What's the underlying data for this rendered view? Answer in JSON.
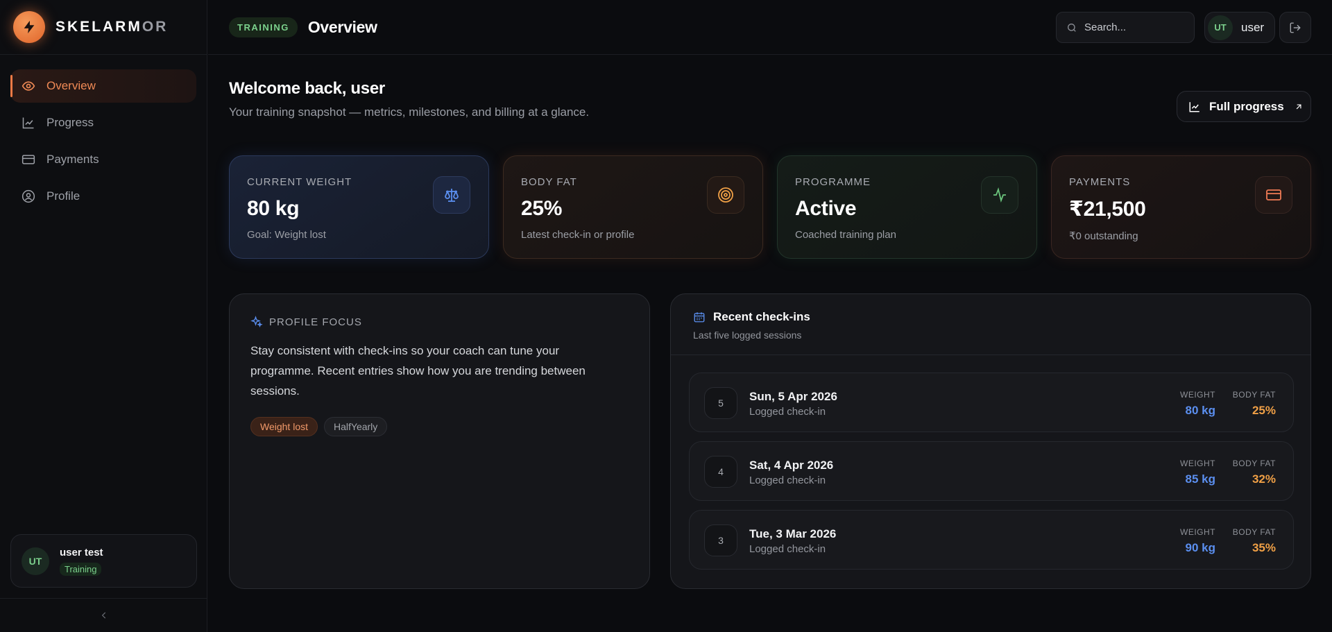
{
  "brand": {
    "name_bright": "SKELARM",
    "name_dim": "OR"
  },
  "sidebar": {
    "items": [
      {
        "label": "Overview",
        "icon": "eye-icon",
        "active": true
      },
      {
        "label": "Progress",
        "icon": "chart-line-icon",
        "active": false
      },
      {
        "label": "Payments",
        "icon": "credit-card-icon",
        "active": false
      },
      {
        "label": "Profile",
        "icon": "user-circle-icon",
        "active": false
      }
    ],
    "user": {
      "initials": "UT",
      "name": "user test",
      "badge": "Training"
    },
    "collapse_icon": "chevron-left-icon"
  },
  "header": {
    "tag": "TRAINING",
    "title": "Overview",
    "search_placeholder": "Search...",
    "user_initials": "UT",
    "user_name": "user"
  },
  "welcome": {
    "title": "Welcome back, user",
    "subtitle": "Your training snapshot — metrics, milestones, and billing at a glance.",
    "button": "Full progress"
  },
  "stats": [
    {
      "label": "CURRENT WEIGHT",
      "value": "80 kg",
      "sub": "Goal: Weight lost",
      "icon": "scale-icon",
      "color": "#5b8ff0"
    },
    {
      "label": "BODY FAT",
      "value": "25%",
      "sub": "Latest check-in or profile",
      "icon": "target-icon",
      "color": "#f0a046"
    },
    {
      "label": "PROGRAMME",
      "value": "Active",
      "sub": "Coached training plan",
      "icon": "activity-icon",
      "color": "#6bc57d"
    },
    {
      "label": "PAYMENTS",
      "value": "₹21,500",
      "sub": "₹0 outstanding",
      "icon": "credit-card-icon",
      "color": "#ef7a55"
    }
  ],
  "focus": {
    "label": "PROFILE FOCUS",
    "text": "Stay consistent with check-ins so your coach can tune your programme. Recent entries show how you are trending between sessions.",
    "chips": [
      "Weight lost",
      "HalfYearly"
    ]
  },
  "recent": {
    "title": "Recent check-ins",
    "subtitle": "Last five logged sessions",
    "weight_label": "WEIGHT",
    "bodyfat_label": "BODY FAT",
    "entries": [
      {
        "num": "5",
        "date": "Sun, 5 Apr 2026",
        "sub": "Logged check-in",
        "weight": "80 kg",
        "bodyfat": "25%"
      },
      {
        "num": "4",
        "date": "Sat, 4 Apr 2026",
        "sub": "Logged check-in",
        "weight": "85 kg",
        "bodyfat": "32%"
      },
      {
        "num": "3",
        "date": "Tue, 3 Mar 2026",
        "sub": "Logged check-in",
        "weight": "90 kg",
        "bodyfat": "35%"
      }
    ]
  },
  "colors": {
    "accent": "#ef7a45",
    "success": "#7bd18c",
    "blue": "#5b8ff0",
    "amber": "#f0a046"
  }
}
